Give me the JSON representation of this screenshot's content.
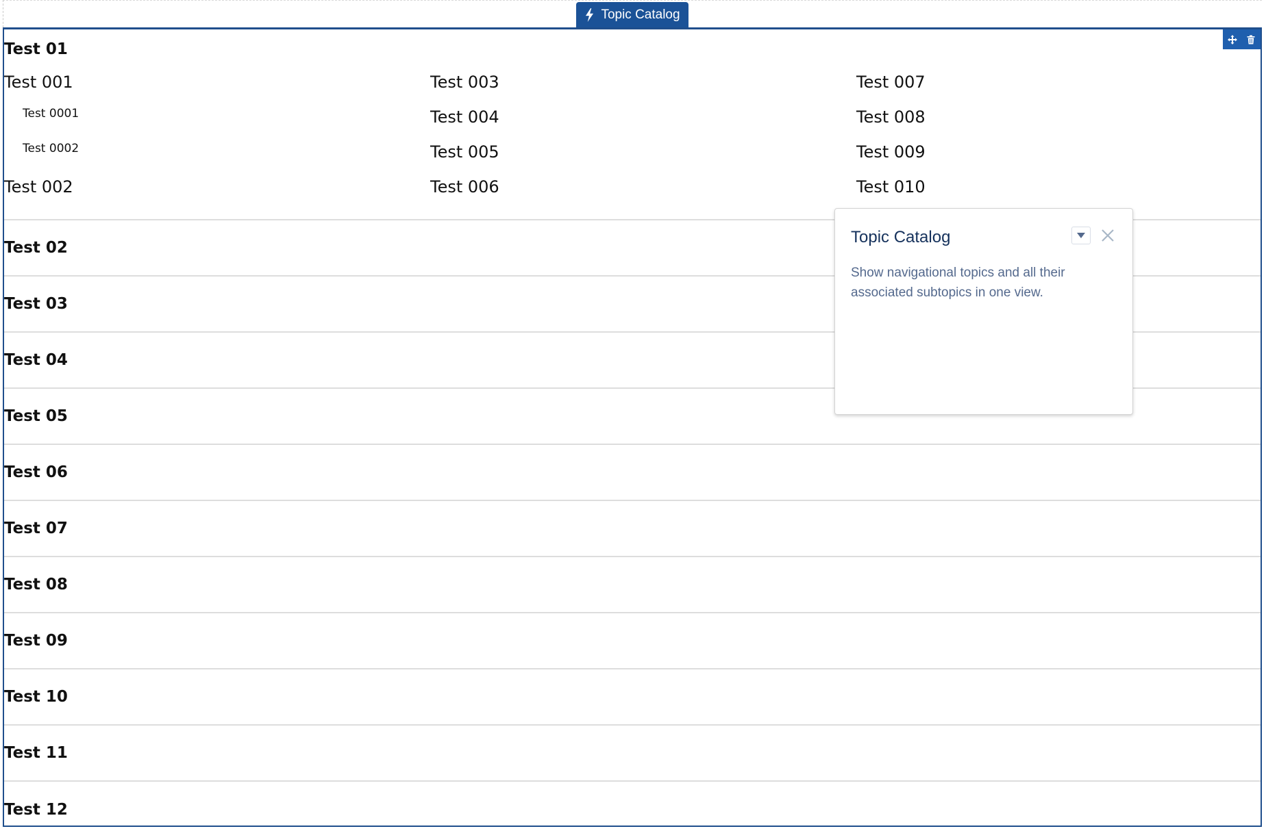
{
  "tab": {
    "label": "Topic Catalog",
    "icon": "bolt-icon"
  },
  "toolbar": {
    "move_icon": "move-icon",
    "delete_icon": "trash-icon"
  },
  "catalog": {
    "first_topic": {
      "title": "Test 01",
      "columns": [
        [
          {
            "label": "Test 001",
            "level": 1
          },
          {
            "label": "Test 0001",
            "level": 2
          },
          {
            "label": "Test 0002",
            "level": 2
          },
          {
            "label": "Test 002",
            "level": 1
          }
        ],
        [
          {
            "label": "Test 003",
            "level": 1
          },
          {
            "label": "Test 004",
            "level": 1
          },
          {
            "label": "Test 005",
            "level": 1
          },
          {
            "label": "Test 006",
            "level": 1
          }
        ],
        [
          {
            "label": "Test 007",
            "level": 1
          },
          {
            "label": "Test 008",
            "level": 1
          },
          {
            "label": "Test 009",
            "level": 1
          },
          {
            "label": "Test 010",
            "level": 1
          }
        ]
      ]
    },
    "topics": [
      "Test 02",
      "Test 03",
      "Test 04",
      "Test 05",
      "Test 06",
      "Test 07",
      "Test 08",
      "Test 09",
      "Test 10",
      "Test 11",
      "Test 12"
    ]
  },
  "popover": {
    "title": "Topic Catalog",
    "description": "Show navigational topics and all their associated subtopics in one view.",
    "dropdown_icon": "caret-down-icon",
    "close_icon": "close-icon"
  },
  "colors": {
    "accent": "#1b5297",
    "frame": "#1f4e8c",
    "popover_title": "#16325c",
    "popover_text": "#54698d"
  }
}
